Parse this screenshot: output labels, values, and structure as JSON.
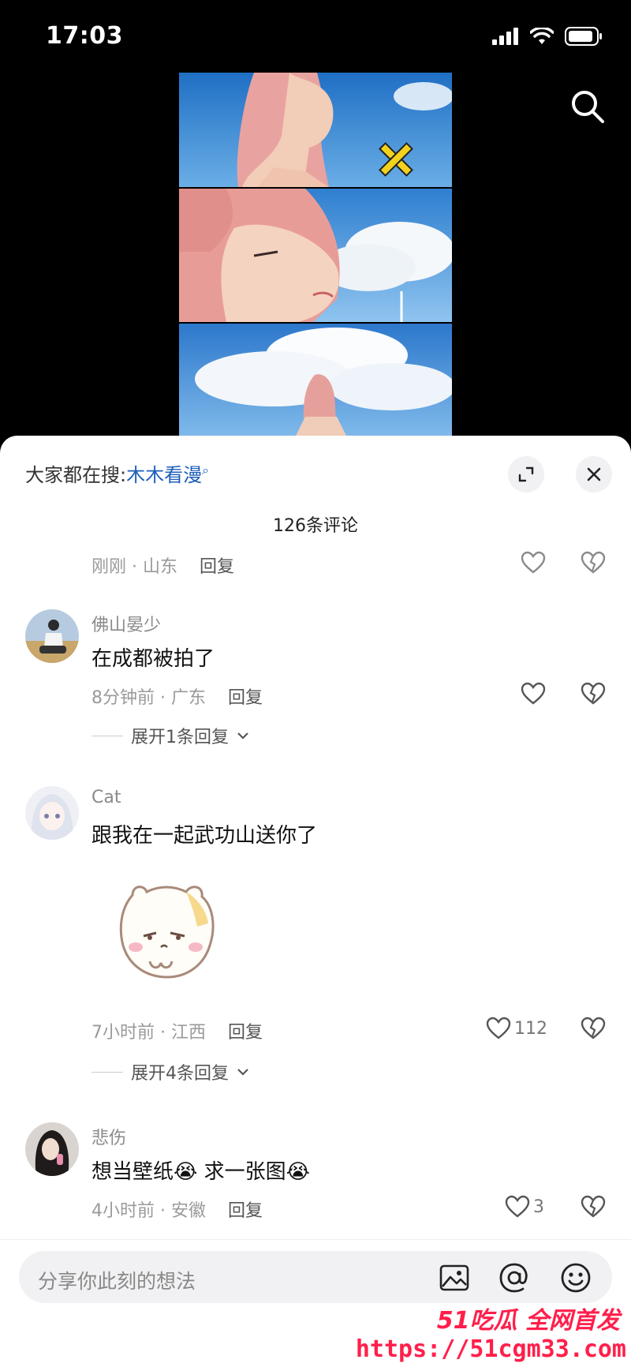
{
  "status": {
    "time": "17:03"
  },
  "sheet": {
    "trending_prefix": "大家都在搜:",
    "trending_term": "木木看漫",
    "comment_count": "126条评论"
  },
  "comments": [
    {
      "meta": "刚刚 · 山东",
      "reply": "回复"
    },
    {
      "user": "佛山晏少",
      "text": "在成都被拍了",
      "meta": "8分钟前 · 广东",
      "reply": "回复",
      "expand": "展开1条回复"
    },
    {
      "user": "Cat",
      "text": "跟我在一起武功山送你了",
      "meta": "7小时前 · 江西",
      "reply": "回复",
      "likes": "112",
      "expand": "展开4条回复"
    },
    {
      "user": "悲伤",
      "text": "想当壁纸😭 求一张图😭",
      "meta": "4小时前 · 安徽",
      "reply": "回复",
      "likes": "3"
    }
  ],
  "input": {
    "placeholder": "分享你此刻的想法"
  },
  "watermark": {
    "brand": "51吃瓜 全网首发",
    "url": "https://51cgm33.com"
  },
  "icons": {
    "status": [
      "signal-icon",
      "wifi-icon",
      "battery-icon"
    ],
    "header": [
      "search-icon",
      "expand-icon",
      "close-icon"
    ],
    "input": [
      "image-icon",
      "at-icon",
      "emoji-icon"
    ]
  }
}
